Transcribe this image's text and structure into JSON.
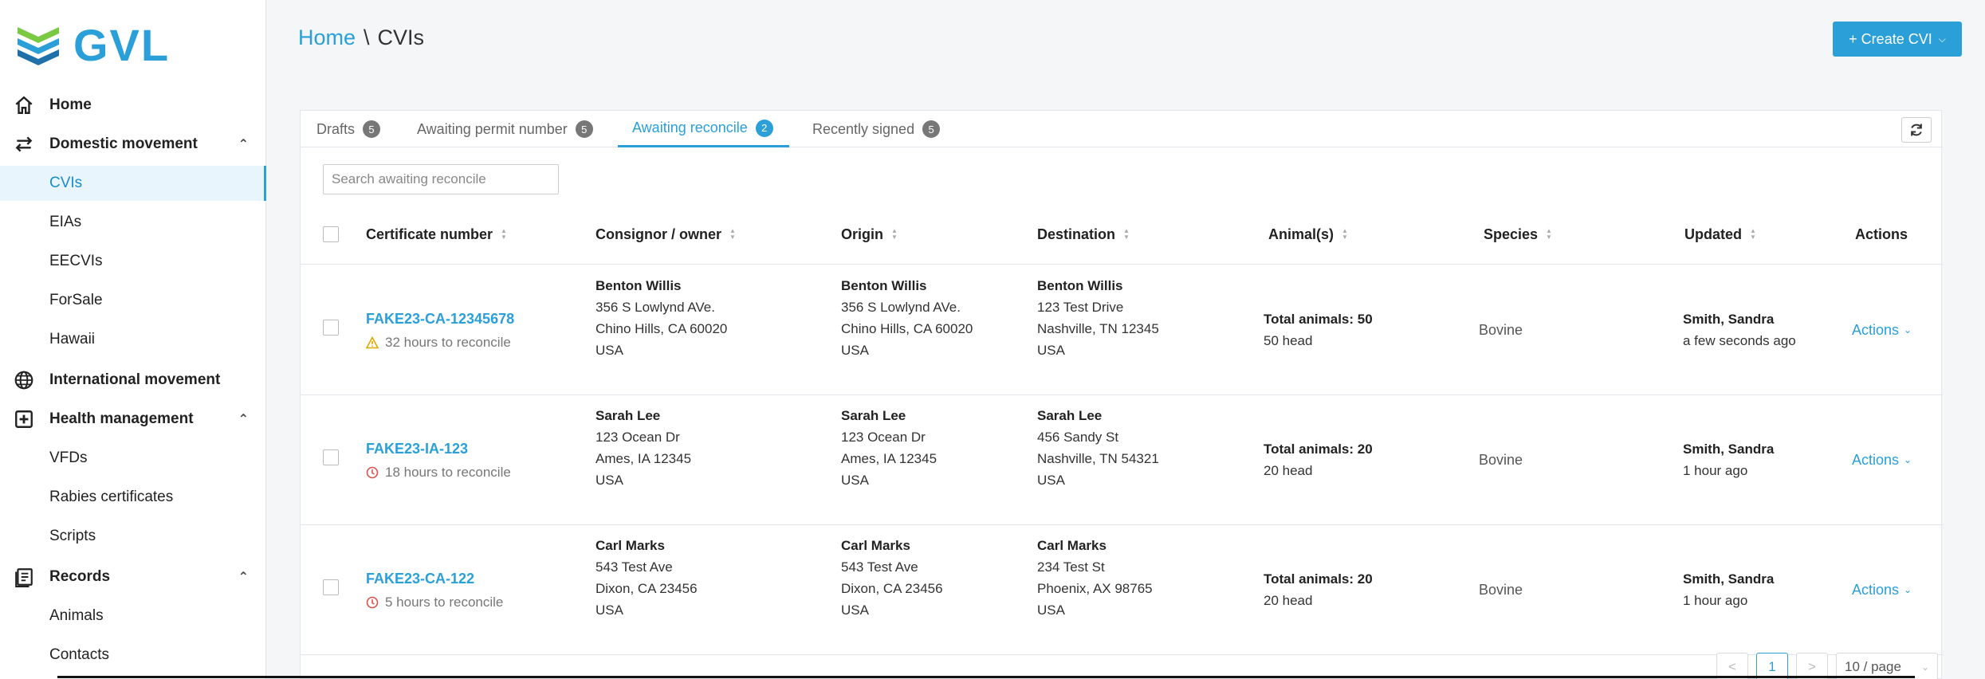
{
  "app": {
    "logo_text": "GVL",
    "brand_color": "#2a9fd8"
  },
  "sidebar": {
    "items": [
      {
        "label": "Home",
        "icon": "home-icon"
      },
      {
        "label": "Domestic movement",
        "icon": "swap-arrows-icon",
        "expanded": true
      },
      {
        "label": "CVIs",
        "active": true
      },
      {
        "label": "EIAs"
      },
      {
        "label": "EECVIs"
      },
      {
        "label": "ForSale"
      },
      {
        "label": "Hawaii"
      },
      {
        "label": "International movement",
        "icon": "globe-icon"
      },
      {
        "label": "Health management",
        "icon": "medical-plus-icon",
        "expanded": true
      },
      {
        "label": "VFDs"
      },
      {
        "label": "Rabies certificates"
      },
      {
        "label": "Scripts"
      },
      {
        "label": "Records",
        "icon": "records-icon",
        "expanded": true
      },
      {
        "label": "Animals"
      },
      {
        "label": "Contacts"
      }
    ]
  },
  "header": {
    "breadcrumb_home": "Home",
    "breadcrumb_sep": "\\",
    "breadcrumb_current": "CVIs",
    "create_button": "+ Create CVI"
  },
  "tabs": [
    {
      "label": "Drafts",
      "count": "5"
    },
    {
      "label": "Awaiting permit number",
      "count": "5"
    },
    {
      "label": "Awaiting reconcile",
      "count": "2",
      "active": true
    },
    {
      "label": "Recently signed",
      "count": "5"
    }
  ],
  "search": {
    "placeholder": "Search awaiting reconcile"
  },
  "table": {
    "columns": [
      "Certificate number",
      "Consignor / owner",
      "Origin",
      "Destination",
      "Animal(s)",
      "Species",
      "Updated",
      "Actions"
    ],
    "rows": [
      {
        "cert": "FAKE23-CA-12345678",
        "reconcile": "32 hours to reconcile",
        "reconcile_icon": "warning-icon",
        "consignor": {
          "name": "Benton Willis",
          "addr1": "356 S Lowlynd AVe.",
          "addr2": "Chino Hills, CA 60020",
          "country": "USA"
        },
        "origin": {
          "name": "Benton Willis",
          "addr1": "356 S Lowlynd AVe.",
          "addr2": "Chino Hills, CA 60020",
          "country": "USA"
        },
        "destination": {
          "name": "Benton Willis",
          "addr1": "123 Test Drive",
          "addr2": "Nashville, TN 12345",
          "country": "USA"
        },
        "animals_total": "Total animals: 50",
        "animals_head": "50 head",
        "species": "Bovine",
        "updated_by": "Smith, Sandra",
        "updated_when": "a few seconds ago",
        "actions": "Actions"
      },
      {
        "cert": "FAKE23-IA-123",
        "reconcile": "18 hours to reconcile",
        "reconcile_icon": "clock-alert-icon",
        "consignor": {
          "name": "Sarah Lee",
          "addr1": "123 Ocean Dr",
          "addr2": "Ames, IA 12345",
          "country": "USA"
        },
        "origin": {
          "name": "Sarah Lee",
          "addr1": "123 Ocean Dr",
          "addr2": "Ames, IA 12345",
          "country": "USA"
        },
        "destination": {
          "name": "Sarah Lee",
          "addr1": "456 Sandy St",
          "addr2": "Nashville, TN 54321",
          "country": "USA"
        },
        "animals_total": "Total animals: 20",
        "animals_head": "20 head",
        "species": "Bovine",
        "updated_by": "Smith, Sandra",
        "updated_when": "1 hour ago",
        "actions": "Actions"
      },
      {
        "cert": "FAKE23-CA-122",
        "reconcile": "5 hours to reconcile",
        "reconcile_icon": "clock-alert-icon",
        "consignor": {
          "name": "Carl Marks",
          "addr1": "543 Test Ave",
          "addr2": "Dixon, CA 23456",
          "country": "USA"
        },
        "origin": {
          "name": "Carl Marks",
          "addr1": "543 Test Ave",
          "addr2": "Dixon, CA 23456",
          "country": "USA"
        },
        "destination": {
          "name": "Carl Marks",
          "addr1": "234 Test St",
          "addr2": "Phoenix, AX 98765",
          "country": "USA"
        },
        "animals_total": "Total animals: 20",
        "animals_head": "20 head",
        "species": "Bovine",
        "updated_by": "Smith, Sandra",
        "updated_when": "1 hour ago",
        "actions": "Actions"
      }
    ]
  },
  "pagination": {
    "prev": "<",
    "current": "1",
    "next": ">",
    "page_size": "10 / page"
  }
}
